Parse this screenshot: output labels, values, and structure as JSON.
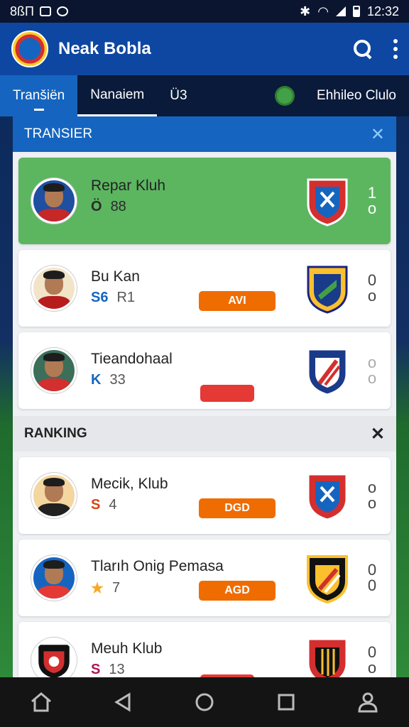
{
  "status_bar": {
    "left_text": "8ßΠ",
    "time": "12:32"
  },
  "app": {
    "title": "Neak Bobla"
  },
  "tabs": [
    {
      "label": "Tranšiën"
    },
    {
      "label": "Nanaiem"
    },
    {
      "label": "Ü3"
    },
    {
      "label": "Ehhileo Clulo"
    }
  ],
  "sections": {
    "transfer": {
      "title": "TRANSIER",
      "close": "✕"
    },
    "ranking": {
      "title": "RANKING",
      "close": "✕"
    }
  },
  "transfer_cards": [
    {
      "name": "Repar Kluh",
      "stat_icon": "Ö",
      "stat": "88",
      "score": [
        "1",
        "o"
      ],
      "button": "",
      "crest": "red"
    },
    {
      "name": "Bu Kan",
      "stat_icon": "S6",
      "stat": "R1",
      "score": [
        "0",
        "o"
      ],
      "button": "AVI",
      "crest": "blue-gold"
    },
    {
      "name": "Tieandohaal",
      "stat_icon": "K",
      "stat": "33",
      "score": [
        "o",
        "o"
      ],
      "button": "",
      "crest": "blue-red"
    }
  ],
  "ranking_cards": [
    {
      "name": "Mecik, Klub",
      "stat_icon": "S",
      "stat": "4",
      "score": [
        "o",
        "o"
      ],
      "button": "DGD",
      "crest": "red"
    },
    {
      "name": "Tlarıh Onig Pemasa",
      "stat_icon": "★",
      "stat": "7",
      "score": [
        "0",
        "0"
      ],
      "button": "AGD",
      "crest": "black-gold"
    },
    {
      "name": "Meuh Klub",
      "stat_icon": "S",
      "stat": "13",
      "score": [
        "0",
        "o"
      ],
      "button": "",
      "crest": "red-black"
    }
  ],
  "colors": {
    "primary": "#0d47a1",
    "highlight": "#5cb660",
    "button_orange": "#ef6c00",
    "button_red": "#e53935"
  }
}
